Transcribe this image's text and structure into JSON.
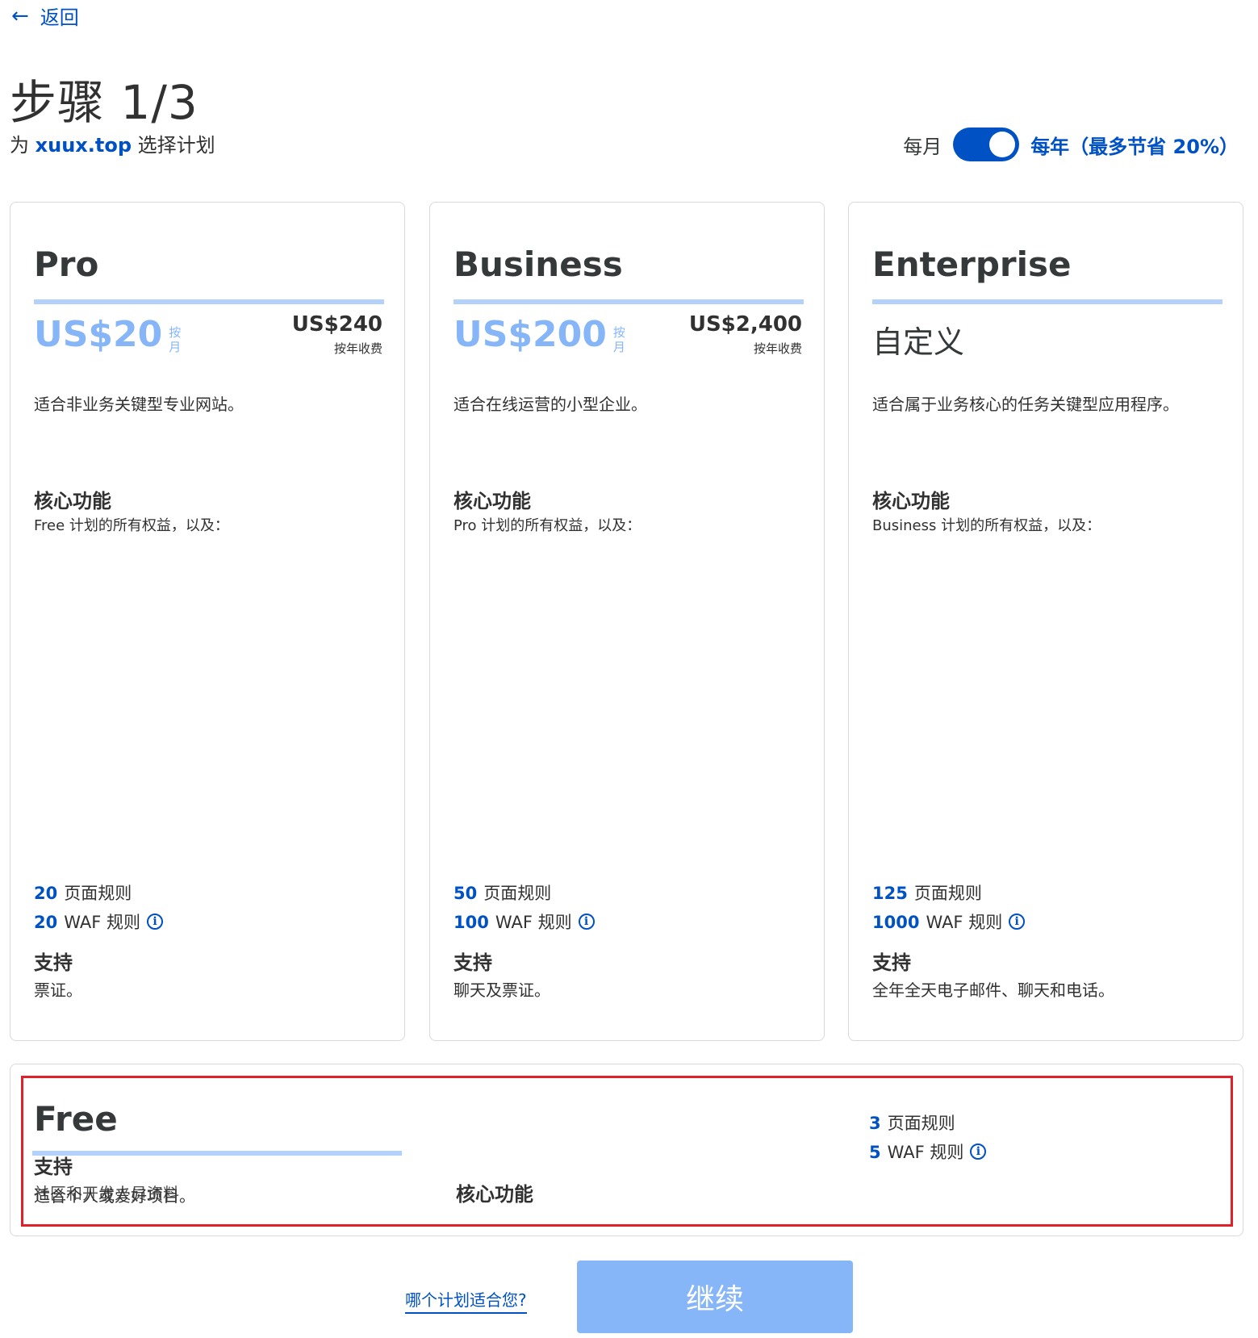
{
  "header": {
    "back_label": "返回",
    "step_title": "步骤 1/3",
    "subtitle_prefix": "为",
    "domain": "xuux.top",
    "subtitle_suffix": "选择计划",
    "billing_monthly": "每月",
    "billing_yearly": "每年（最多节省 20%）",
    "billing_selected": "yearly"
  },
  "plans": [
    {
      "name": "Pro",
      "price": "US$20",
      "per": "按月",
      "annual_total": "US$240",
      "annual_note": "按年收费",
      "description": "适合非业务关键型专业网站。",
      "features_title": "核心功能",
      "features_subtitle": "Free 计划的所有权益，以及：",
      "page_rules_count": "20",
      "page_rules_label": "页面规则",
      "waf_rules_count": "20",
      "waf_rules_label": "WAF 规则",
      "support_title": "支持",
      "support_text": "票证。"
    },
    {
      "name": "Business",
      "price": "US$200",
      "per": "按月",
      "annual_total": "US$2,400",
      "annual_note": "按年收费",
      "description": "适合在线运营的小型企业。",
      "features_title": "核心功能",
      "features_subtitle": "Pro 计划的所有权益，以及：",
      "page_rules_count": "50",
      "page_rules_label": "页面规则",
      "waf_rules_count": "100",
      "waf_rules_label": "WAF 规则",
      "support_title": "支持",
      "support_text": "聊天及票证。"
    },
    {
      "name": "Enterprise",
      "custom_price": "自定义",
      "description": "适合属于业务核心的任务关键型应用程序。",
      "features_title": "核心功能",
      "features_subtitle": "Business 计划的所有权益，以及：",
      "page_rules_count": "125",
      "page_rules_label": "页面规则",
      "waf_rules_count": "1000",
      "waf_rules_label": "WAF 规则",
      "support_title": "支持",
      "support_text": "全年全天电子邮件、聊天和电话。"
    }
  ],
  "free_plan": {
    "name": "Free",
    "support_title": "支持",
    "description": "适合个人或爱好项目。",
    "overlap_text": "社区和开发人员资料",
    "features_title": "核心功能",
    "page_rules_count": "3",
    "page_rules_label": "页面规则",
    "waf_rules_count": "5",
    "waf_rules_label": "WAF 规则"
  },
  "footer": {
    "help_link": "哪个计划适合您?",
    "continue_label": "继续"
  },
  "colors": {
    "accent": "#0051c3",
    "price_light": "#86b6f8",
    "plan_bar": "#b3d1fb",
    "highlight": "#e0202a"
  },
  "icons": {
    "back": "arrow-left-icon",
    "info": "info-circle-icon"
  }
}
